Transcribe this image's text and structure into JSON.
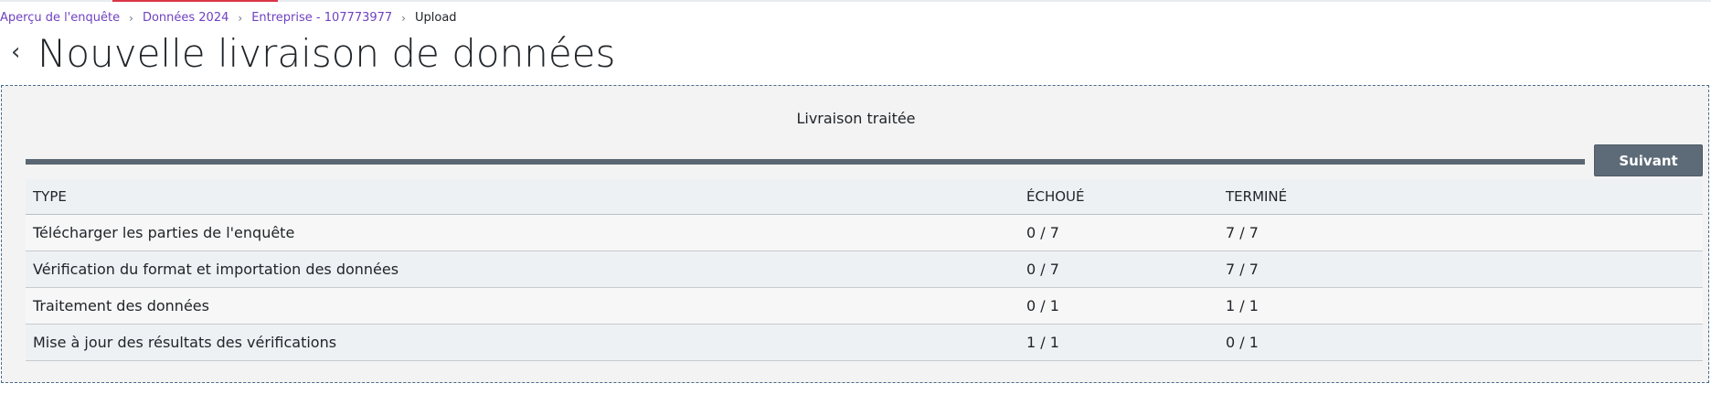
{
  "breadcrumb": {
    "items": [
      "Aperçu de l'enquête",
      "Données 2024",
      "Entreprise - 107773977"
    ],
    "separator": "›",
    "current": "Upload"
  },
  "back_icon": "chevron-left-icon",
  "back_glyph": "‹",
  "page_title": "Nouvelle livraison de données",
  "panel": {
    "status": "Livraison traitée",
    "progress_fraction": 1.0,
    "next_button": "Suivant"
  },
  "table": {
    "headers": {
      "type": "TYPE",
      "failed": "ÉCHOUÉ",
      "done": "TERMINÉ"
    },
    "rows": [
      {
        "type": "Télécharger les parties de l'enquête",
        "failed": "0 / 7",
        "done": "7 / 7"
      },
      {
        "type": "Vérification du format et importation des données",
        "failed": "0 / 7",
        "done": "7 / 7"
      },
      {
        "type": "Traitement des données",
        "failed": "0 / 1",
        "done": "1 / 1"
      },
      {
        "type": "Mise à jour des résultats des vérifications",
        "failed": "1 / 1",
        "done": "0 / 1"
      }
    ]
  },
  "colors": {
    "link": "#6f42c1",
    "success": "#198754",
    "error": "#b00020",
    "button": "#5c6b77",
    "progress": "#5a6772"
  }
}
